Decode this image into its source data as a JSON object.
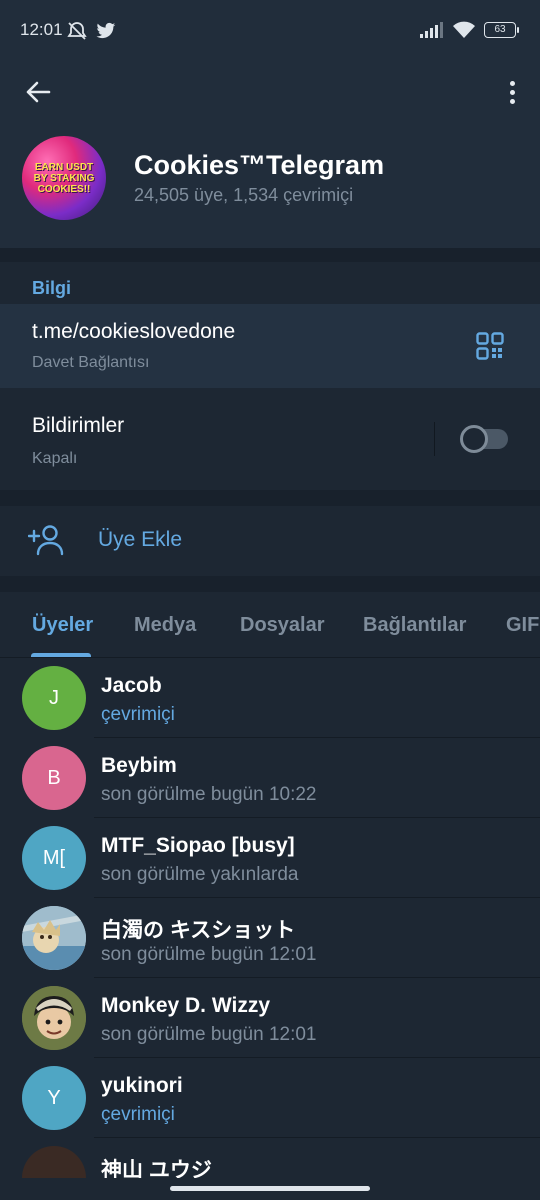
{
  "status_bar": {
    "time": "12:01",
    "battery": "63",
    "icons": [
      "muted-alarm-icon",
      "twitter-icon",
      "signal-icon",
      "wifi-icon",
      "battery-icon"
    ]
  },
  "header": {
    "channel_title": "Cookies™Telegram",
    "channel_subtitle": "24,505 üye, 1,534 çevrimiçi",
    "avatar_text": "EARN USDT BY STAKING COOKIES!!"
  },
  "info": {
    "section_label": "Bilgi",
    "link": "t.me/cookieslovedone",
    "link_caption": "Davet Bağlantısı",
    "notifications_label": "Bildirimler",
    "notifications_state": "Kapalı",
    "notifications_enabled": false
  },
  "actions": {
    "add_member": "Üye Ekle"
  },
  "tabs": [
    {
      "label": "Üyeler",
      "active": true
    },
    {
      "label": "Medya",
      "active": false
    },
    {
      "label": "Dosyalar",
      "active": false
    },
    {
      "label": "Bağlantılar",
      "active": false
    },
    {
      "label": "GIF",
      "active": false
    }
  ],
  "members": [
    {
      "initials": "J",
      "name": "Jacob",
      "status": "çevrimiçi",
      "online": true,
      "color": "#64b042"
    },
    {
      "initials": "B",
      "name": "Beybim",
      "status": "son görülme bugün 10:22",
      "online": false,
      "color": "#d9668f"
    },
    {
      "initials": "M[",
      "name": "MTF_Siopao [busy]",
      "status": "son görülme yakınlarda",
      "online": false,
      "color": "#4fa6c4"
    },
    {
      "initials": "",
      "name": "白濁の キスショット",
      "status": "son görülme bugün 12:01",
      "online": false,
      "color": "#8fb4c9"
    },
    {
      "initials": "",
      "name": "Monkey D. Wizzy",
      "status": "son görülme bugün 12:01",
      "online": false,
      "color": "#5b6b3a"
    },
    {
      "initials": "Y",
      "name": "yukinori",
      "status": "çevrimiçi",
      "online": true,
      "color": "#4fa6c4"
    },
    {
      "initials": "",
      "name": "神山 ユウジ",
      "status": "",
      "online": false,
      "color": "#3a2a24"
    }
  ]
}
